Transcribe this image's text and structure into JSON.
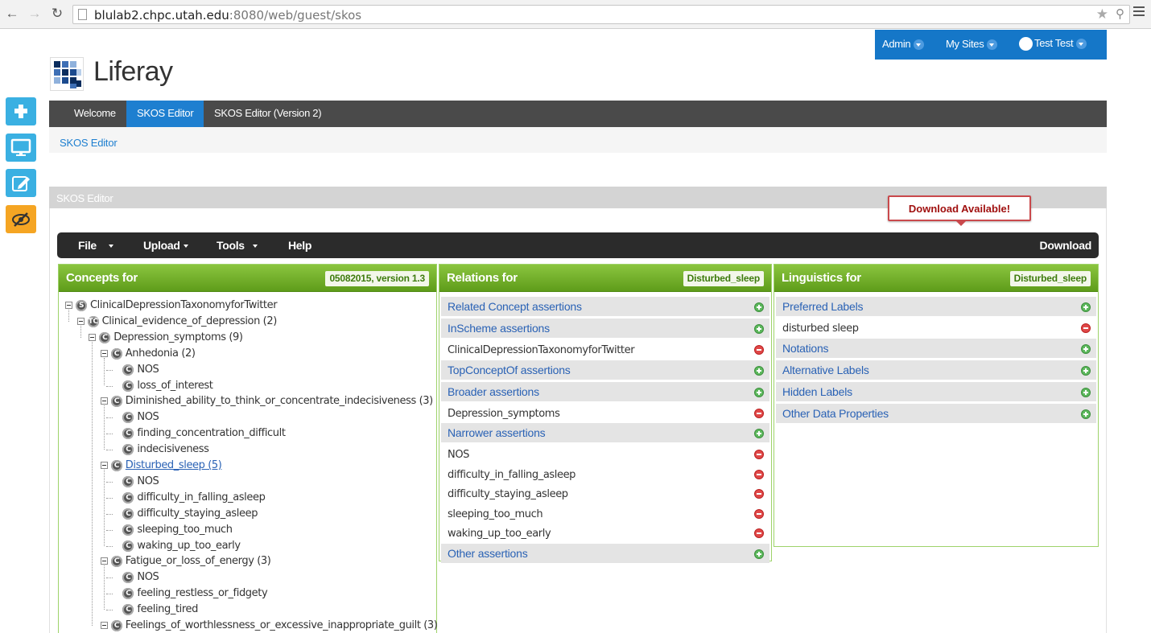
{
  "browser": {
    "url_host": "blulab2.chpc.utah.edu",
    "url_rest": ":8080/web/guest/skos"
  },
  "dockbar": {
    "admin": "Admin",
    "my_sites": "My Sites",
    "user": "Test Test",
    "color": "#1577c8"
  },
  "site": {
    "title": "Liferay",
    "nav": [
      {
        "label": "Welcome",
        "active": false
      },
      {
        "label": "SKOS Editor",
        "active": true
      },
      {
        "label": "SKOS Editor (Version 2)",
        "active": false
      }
    ],
    "breadcrumb": "SKOS Editor"
  },
  "side_buttons": [
    {
      "icon": "plus-icon"
    },
    {
      "icon": "monitor-icon"
    },
    {
      "icon": "edit-icon"
    },
    {
      "icon": "eye-slash-icon"
    }
  ],
  "portlet": {
    "title": "SKOS Editor",
    "download_available": "Download Available!",
    "toolbar": {
      "file": "File",
      "upload": "Upload",
      "tools": "Tools",
      "help": "Help",
      "download": "Download"
    }
  },
  "concepts": {
    "title": "Concepts for",
    "badge": "05082015, version 1.3",
    "tree": [
      {
        "label": "ClinicalDepressionTaxonomyforTwitter",
        "icon": "S",
        "depth": 0,
        "expandable": true
      },
      {
        "label": "Clinical_evidence_of_depression (2)",
        "icon": "TC",
        "depth": 1,
        "expandable": true
      },
      {
        "label": "Depression_symptoms (9)",
        "icon": "C",
        "depth": 2,
        "expandable": true
      },
      {
        "label": "Anhedonia (2)",
        "icon": "C",
        "depth": 3,
        "expandable": true
      },
      {
        "label": "NOS",
        "icon": "C",
        "depth": 4,
        "expandable": false
      },
      {
        "label": "loss_of_interest",
        "icon": "C",
        "depth": 4,
        "expandable": false
      },
      {
        "label": "Diminished_ability_to_think_or_concentrate_indecisiveness (3)",
        "icon": "C",
        "depth": 3,
        "expandable": true
      },
      {
        "label": "NOS",
        "icon": "C",
        "depth": 4,
        "expandable": false
      },
      {
        "label": "finding_concentration_difficult",
        "icon": "C",
        "depth": 4,
        "expandable": false
      },
      {
        "label": "indecisiveness",
        "icon": "C",
        "depth": 4,
        "expandable": false
      },
      {
        "label": "Disturbed_sleep (5)",
        "icon": "C",
        "depth": 3,
        "expandable": true,
        "selected": true
      },
      {
        "label": "NOS",
        "icon": "C",
        "depth": 4,
        "expandable": false
      },
      {
        "label": "difficulty_in_falling_asleep",
        "icon": "C",
        "depth": 4,
        "expandable": false
      },
      {
        "label": "difficulty_staying_asleep",
        "icon": "C",
        "depth": 4,
        "expandable": false
      },
      {
        "label": "sleeping_too_much",
        "icon": "C",
        "depth": 4,
        "expandable": false
      },
      {
        "label": "waking_up_too_early",
        "icon": "C",
        "depth": 4,
        "expandable": false
      },
      {
        "label": "Fatigue_or_loss_of_energy (3)",
        "icon": "C",
        "depth": 3,
        "expandable": true
      },
      {
        "label": "NOS",
        "icon": "C",
        "depth": 4,
        "expandable": false
      },
      {
        "label": "feeling_restless_or_fidgety",
        "icon": "C",
        "depth": 4,
        "expandable": false
      },
      {
        "label": "feeling_tired",
        "icon": "C",
        "depth": 4,
        "expandable": false
      },
      {
        "label": "Feelings_of_worthlessness_or_excessive_inappropriate_guilt (3)",
        "icon": "C",
        "depth": 3,
        "expandable": true
      }
    ]
  },
  "relations": {
    "title": "Relations for",
    "badge": "Disturbed_sleep",
    "rows": [
      {
        "type": "section",
        "text": "Related Concept assertions"
      },
      {
        "type": "section",
        "text": "InScheme assertions"
      },
      {
        "type": "value",
        "text": "ClinicalDepressionTaxonomyforTwitter"
      },
      {
        "type": "section",
        "text": "TopConceptOf assertions"
      },
      {
        "type": "section",
        "text": "Broader assertions"
      },
      {
        "type": "value",
        "text": "Depression_symptoms"
      },
      {
        "type": "section",
        "text": "Narrower assertions"
      },
      {
        "type": "value",
        "text": "NOS"
      },
      {
        "type": "value",
        "text": "difficulty_in_falling_asleep"
      },
      {
        "type": "value",
        "text": "difficulty_staying_asleep"
      },
      {
        "type": "value",
        "text": "sleeping_too_much"
      },
      {
        "type": "value",
        "text": "waking_up_too_early"
      },
      {
        "type": "section",
        "text": "Other assertions"
      }
    ]
  },
  "linguistics": {
    "title": "Linguistics for",
    "badge": "Disturbed_sleep",
    "rows": [
      {
        "type": "section",
        "text": "Preferred Labels"
      },
      {
        "type": "value",
        "text": "disturbed sleep"
      },
      {
        "type": "section",
        "text": "Notations"
      },
      {
        "type": "section",
        "text": "Alternative Labels"
      },
      {
        "type": "section",
        "text": "Hidden Labels"
      },
      {
        "type": "section",
        "text": "Other Data Properties"
      }
    ]
  }
}
